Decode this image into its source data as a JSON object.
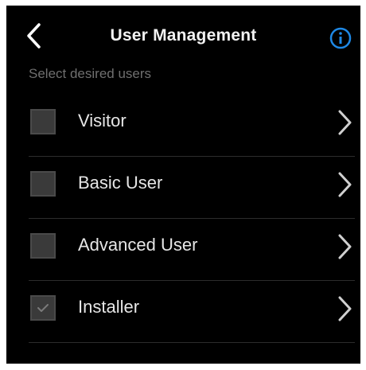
{
  "header": {
    "title": "User Management",
    "back_icon": "chevron-left-icon",
    "info_icon": "info-icon"
  },
  "subtitle": "Select desired users",
  "colors": {
    "background": "#000000",
    "accent": "#1e88e5",
    "text": "#e6e6e6",
    "subtle_text": "#6f6f6f",
    "checkbox": "#3a3a3a",
    "divider": "#2c2c2c"
  },
  "users": [
    {
      "label": "Visitor",
      "checked": false
    },
    {
      "label": "Basic User",
      "checked": false
    },
    {
      "label": "Advanced User",
      "checked": false
    },
    {
      "label": "Installer",
      "checked": true
    }
  ]
}
